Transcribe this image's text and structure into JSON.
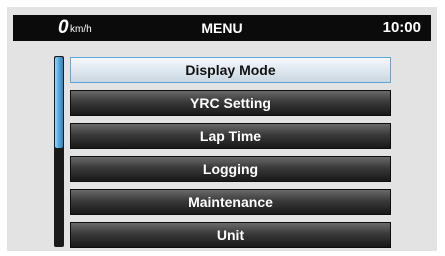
{
  "status_bar": {
    "speed_value": "0",
    "speed_unit": "km/h",
    "title": "MENU",
    "time": "10:00"
  },
  "menu": {
    "items": [
      {
        "label": "Display Mode"
      },
      {
        "label": "YRC Setting"
      },
      {
        "label": "Lap Time"
      },
      {
        "label": "Logging"
      },
      {
        "label": "Maintenance"
      },
      {
        "label": "Unit"
      }
    ],
    "selected_index": 0
  },
  "scrollbar": {
    "visible_fraction": 0.48,
    "position_fraction": 0.0
  },
  "colors": {
    "status_bar_bg": "#0b0b0b",
    "screen_bg": "#e3e3e3",
    "item_bg": "#2a2a2a",
    "selected_item_bg": "#dde6ee",
    "selected_border": "#5aa8dc",
    "scroll_thumb": "#4aa6df"
  }
}
